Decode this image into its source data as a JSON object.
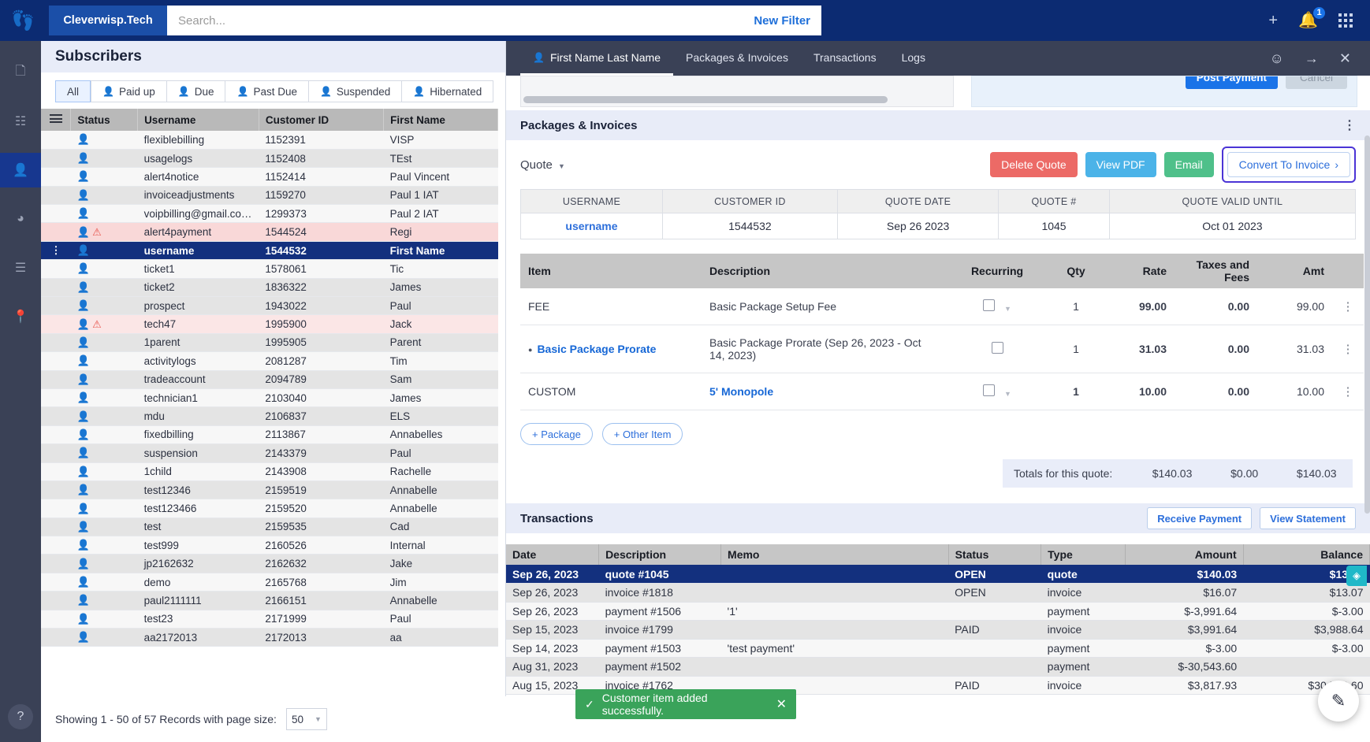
{
  "topbar": {
    "brand": "Cleverwisp.Tech",
    "search_placeholder": "Search...",
    "search_value": "",
    "new_filter": "New Filter",
    "notification_count": "1"
  },
  "rail": {
    "items": [
      {
        "name": "copy-icon",
        "glyph": "❐"
      },
      {
        "name": "dashboard-icon",
        "glyph": "❖"
      },
      {
        "name": "subscribers-icon",
        "glyph": "@"
      },
      {
        "name": "support-icon",
        "glyph": "◔"
      },
      {
        "name": "list-icon",
        "glyph": "☰"
      },
      {
        "name": "map-pin-icon",
        "glyph": "⚑"
      }
    ],
    "help": "?"
  },
  "subscribers": {
    "title": "Subscribers",
    "tabs": [
      {
        "label": "All",
        "active": true
      },
      {
        "label": "Paid up",
        "active": false
      },
      {
        "label": "Due",
        "active": false
      },
      {
        "label": "Past Due",
        "active": false
      },
      {
        "label": "Suspended",
        "active": false
      },
      {
        "label": "Hibernated",
        "active": false
      }
    ],
    "columns": [
      "Status",
      "Username",
      "Customer ID",
      "First Name"
    ],
    "rows": [
      {
        "status": "red",
        "username": "flexiblebilling",
        "cid": "1152391",
        "first": "VISP",
        "style": "plain"
      },
      {
        "status": "grey",
        "username": "usagelogs",
        "cid": "1152408",
        "first": "TEst",
        "style": "alt"
      },
      {
        "status": "red",
        "username": "alert4notice",
        "cid": "1152414",
        "first": "Paul Vincent",
        "style": "plain"
      },
      {
        "status": "green",
        "username": "invoiceadjustments",
        "cid": "1159270",
        "first": "Paul 1 IAT",
        "style": "alt"
      },
      {
        "status": "red",
        "username": "voipbilling@gmail.co…",
        "cid": "1299373",
        "first": "Paul 2 IAT",
        "style": "plain"
      },
      {
        "status": "alert",
        "username": "alert4payment",
        "cid": "1544524",
        "first": "Regi",
        "style": "warn"
      },
      {
        "status": "orange",
        "username": "username",
        "cid": "1544532",
        "first": "First Name",
        "style": "sel"
      },
      {
        "status": "red",
        "username": "ticket1",
        "cid": "1578061",
        "first": "Tic",
        "style": "plain"
      },
      {
        "status": "red",
        "username": "ticket2",
        "cid": "1836322",
        "first": "James",
        "style": "alt"
      },
      {
        "status": "red",
        "username": "prospect",
        "cid": "1943022",
        "first": "Paul",
        "style": "alt"
      },
      {
        "status": "alert",
        "username": "tech47",
        "cid": "1995900",
        "first": "Jack",
        "style": "warn2"
      },
      {
        "status": "red",
        "username": "1parent",
        "cid": "1995905",
        "first": "Parent",
        "style": "alt"
      },
      {
        "status": "red",
        "username": "activitylogs",
        "cid": "2081287",
        "first": "Tim",
        "style": "plain"
      },
      {
        "status": "red",
        "username": "tradeaccount",
        "cid": "2094789",
        "first": "Sam",
        "style": "alt"
      },
      {
        "status": "green",
        "username": "technician1",
        "cid": "2103040",
        "first": "James",
        "style": "plain"
      },
      {
        "status": "green",
        "username": "mdu",
        "cid": "2106837",
        "first": "ELS",
        "style": "alt"
      },
      {
        "status": "green",
        "username": "fixedbilling",
        "cid": "2113867",
        "first": "Annabelles",
        "style": "plain"
      },
      {
        "status": "susp",
        "username": "suspension",
        "cid": "2143379",
        "first": "Paul",
        "style": "alt"
      },
      {
        "status": "red",
        "username": "1child",
        "cid": "2143908",
        "first": "Rachelle",
        "style": "plain"
      },
      {
        "status": "grey",
        "username": "test12346",
        "cid": "2159519",
        "first": "Annabelle",
        "style": "alt"
      },
      {
        "status": "red",
        "username": "test123466",
        "cid": "2159520",
        "first": "Annabelle",
        "style": "plain"
      },
      {
        "status": "grey",
        "username": "test",
        "cid": "2159535",
        "first": "Cad",
        "style": "alt"
      },
      {
        "status": "red",
        "username": "test999",
        "cid": "2160526",
        "first": "Internal",
        "style": "plain"
      },
      {
        "status": "grey",
        "username": "jp2162632",
        "cid": "2162632",
        "first": "Jake",
        "style": "alt"
      },
      {
        "status": "red",
        "username": "demo",
        "cid": "2165768",
        "first": "Jim",
        "style": "plain"
      },
      {
        "status": "red",
        "username": "paul2111111",
        "cid": "2166151",
        "first": "Annabelle",
        "style": "alt"
      },
      {
        "status": "grey",
        "username": "test23",
        "cid": "2171999",
        "first": "Paul",
        "style": "plain"
      },
      {
        "status": "red",
        "username": "aa2172013",
        "cid": "2172013",
        "first": "aa",
        "style": "alt"
      }
    ],
    "footer_text": "Showing 1 - 50 of 57 Records with page size:",
    "page_size": "50"
  },
  "drawer": {
    "tabs": [
      {
        "label": "First Name Last Name",
        "active": true
      },
      {
        "label": "Packages & Invoices",
        "active": false
      },
      {
        "label": "Transactions",
        "active": false
      },
      {
        "label": "Logs",
        "active": false
      }
    ],
    "post_payment": "Post Payment",
    "cancel": "Cancel",
    "packages": {
      "title": "Packages & Invoices",
      "quote_label": "Quote",
      "buttons": {
        "delete": "Delete Quote",
        "pdf": "View PDF",
        "email": "Email",
        "convert": "Convert To Invoice"
      },
      "info_headers": [
        "USERNAME",
        "CUSTOMER ID",
        "QUOTE DATE",
        "QUOTE #",
        "QUOTE VALID UNTIL"
      ],
      "info_values": [
        "username",
        "1544532",
        "Sep 26 2023",
        "1045",
        "Oct 01 2023"
      ],
      "item_headers": [
        "Item",
        "Description",
        "Recurring",
        "Qty",
        "Rate",
        "Taxes and Fees",
        "Amt"
      ],
      "items": [
        {
          "item": "FEE",
          "link": false,
          "bullet": false,
          "description": "Basic Package Setup Fee",
          "desc_link": false,
          "caret": true,
          "qty": "1",
          "qty_link": false,
          "rate": "99.00",
          "taxes": "0.00",
          "amt": "99.00",
          "amt_link": false
        },
        {
          "item": "Basic Package Prorate",
          "link": true,
          "bullet": true,
          "description": "Basic Package Prorate (Sep 26, 2023 - Oct 14, 2023)",
          "desc_link": false,
          "caret": false,
          "qty": "1",
          "qty_link": false,
          "rate": "31.03",
          "taxes": "0.00",
          "amt": "31.03",
          "amt_link": false
        },
        {
          "item": "CUSTOM",
          "link": false,
          "bullet": false,
          "description": "5' Monopole",
          "desc_link": true,
          "caret": true,
          "qty": "1",
          "qty_link": true,
          "rate": "10.00",
          "taxes": "0.00",
          "amt": "10.00",
          "amt_link": true
        }
      ],
      "add_package": "+ Package",
      "add_other": "+ Other Item",
      "totals_label": "Totals for this quote:",
      "totals": [
        "$140.03",
        "$0.00",
        "$140.03"
      ]
    },
    "transactions": {
      "title": "Transactions",
      "receive_payment": "Receive Payment",
      "view_statement": "View Statement",
      "columns": [
        "Date",
        "Description",
        "Memo",
        "Status",
        "Type",
        "Amount",
        "Balance"
      ],
      "rows": [
        {
          "date": "Sep 26, 2023",
          "desc": "quote #1045",
          "memo": "",
          "status": "OPEN",
          "type": "quote",
          "amount": "$140.03",
          "balance": "$13.07",
          "style": "sel"
        },
        {
          "date": "Sep 26, 2023",
          "desc": "invoice #1818",
          "memo": "",
          "status": "OPEN",
          "type": "invoice",
          "amount": "$16.07",
          "balance": "$13.07",
          "style": "alt"
        },
        {
          "date": "Sep 26, 2023",
          "desc": "payment #1506",
          "memo": "'1'",
          "status": "",
          "type": "payment",
          "amount": "$-3,991.64",
          "balance": "$-3.00",
          "style": "plain"
        },
        {
          "date": "Sep 15, 2023",
          "desc": "invoice #1799",
          "memo": "",
          "status": "PAID",
          "type": "invoice",
          "amount": "$3,991.64",
          "balance": "$3,988.64",
          "style": "alt"
        },
        {
          "date": "Sep 14, 2023",
          "desc": "payment #1503",
          "memo": "'test payment'",
          "status": "",
          "type": "payment",
          "amount": "$-3.00",
          "balance": "$-3.00",
          "style": "plain"
        },
        {
          "date": "Aug 31, 2023",
          "desc": "payment #1502",
          "memo": "",
          "status": "",
          "type": "payment",
          "amount": "$-30,543.60",
          "balance": "",
          "style": "alt"
        },
        {
          "date": "Aug 15, 2023",
          "desc": "invoice #1762",
          "memo": "",
          "status": "PAID",
          "type": "invoice",
          "amount": "$3,817.93",
          "balance": "$30,543.60",
          "style": "plain"
        }
      ]
    }
  },
  "toast": {
    "message": "Customer item added successfully."
  }
}
